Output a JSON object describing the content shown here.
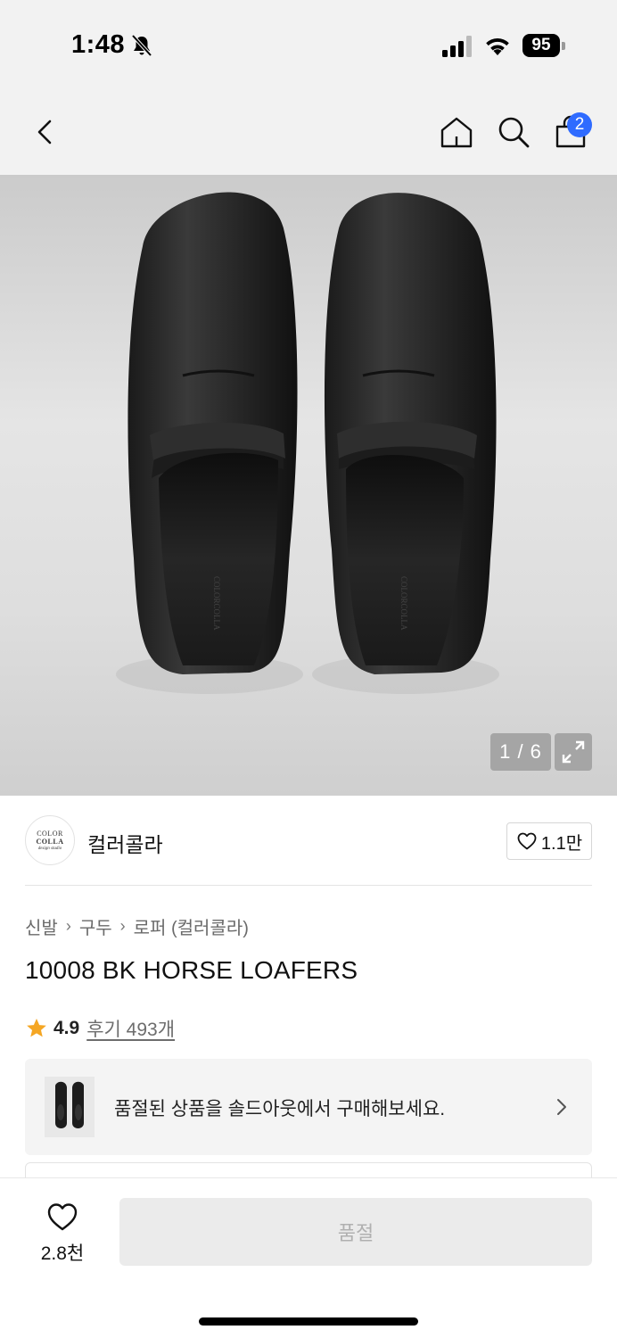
{
  "status_bar": {
    "time": "1:48",
    "battery": "95",
    "icons": [
      "bell-slash-icon",
      "signal-icon",
      "wifi-icon",
      "battery-icon"
    ]
  },
  "nav": {
    "icons": [
      "back-icon",
      "home-icon",
      "search-icon",
      "cart-icon"
    ],
    "cart_badge": "2"
  },
  "gallery": {
    "counter": "1 / 6",
    "expand_icon": "expand-icon"
  },
  "brand": {
    "logo_line1": "COLOR",
    "logo_line2": "COLLA",
    "logo_line3": "design studio",
    "name": "컬러콜라",
    "like_count": "1.1만"
  },
  "breadcrumb": [
    "신발",
    "구두",
    "로퍼 (컬러콜라)"
  ],
  "product": {
    "title": "10008 BK HORSE LOAFERS",
    "rating": "4.9",
    "review_link": "후기 493개"
  },
  "soldout_banner": {
    "text": "품절된 상품을 솔드아웃에서 구매해보세요."
  },
  "bottom_bar": {
    "wish_count": "2.8천",
    "buy_button": "품절"
  },
  "colors": {
    "accent_badge": "#2f6bff",
    "star": "#f5a623",
    "disabled_button_bg": "#ebebeb",
    "disabled_button_text": "#b0b0b0"
  }
}
